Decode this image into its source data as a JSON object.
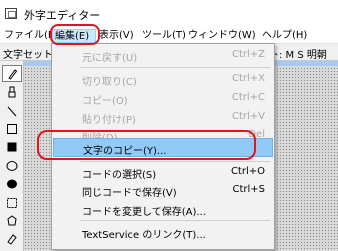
{
  "window": {
    "title": "外字エディター"
  },
  "menubar": {
    "items": [
      {
        "label": "ファイル(F)"
      },
      {
        "label": "編集(E)"
      },
      {
        "label": "表示(V)"
      },
      {
        "label": "ツール(T)"
      },
      {
        "label": "ウィンドウ(W)"
      },
      {
        "label": "ヘルプ(H)"
      }
    ]
  },
  "toolbar": {
    "charset_label": "文字セット:",
    "font_label": "ォント: M S 明朝"
  },
  "palette": {
    "tools": [
      "pencil-icon",
      "brush-icon",
      "line-icon",
      "hollow-rectangle-icon",
      "filled-rectangle-icon",
      "hollow-ellipse-icon",
      "filled-ellipse-icon",
      "rectangle-select-icon",
      "freeform-select-icon",
      "eraser-icon"
    ]
  },
  "edit_menu": {
    "items": [
      {
        "label": "元に戻す(U)",
        "shortcut": "Ctrl+Z",
        "disabled": true
      },
      {
        "label": "切り取り(C)",
        "shortcut": "Ctrl+X",
        "disabled": true
      },
      {
        "label": "コピー(O)",
        "shortcut": "Ctrl+C",
        "disabled": true
      },
      {
        "label": "貼り付け(P)",
        "shortcut": "Ctrl+V",
        "disabled": true
      },
      {
        "label": "削除(D)",
        "shortcut": "Del",
        "disabled": true
      },
      {
        "label": "文字のコピー(Y)...",
        "shortcut": "",
        "disabled": false,
        "highlighted": true
      },
      {
        "label": "コードの選択(S)",
        "shortcut": "Ctrl+O",
        "disabled": false
      },
      {
        "label": "同じコードで保存(V)",
        "shortcut": "Ctrl+S",
        "disabled": false
      },
      {
        "label": "コードを変更して保存(A)...",
        "shortcut": "",
        "disabled": false
      },
      {
        "label": "TextService のリンク(T)...",
        "shortcut": "",
        "disabled": false
      }
    ]
  },
  "colors": {
    "annotation": "#e0161c",
    "highlight": "#91c9f7"
  }
}
